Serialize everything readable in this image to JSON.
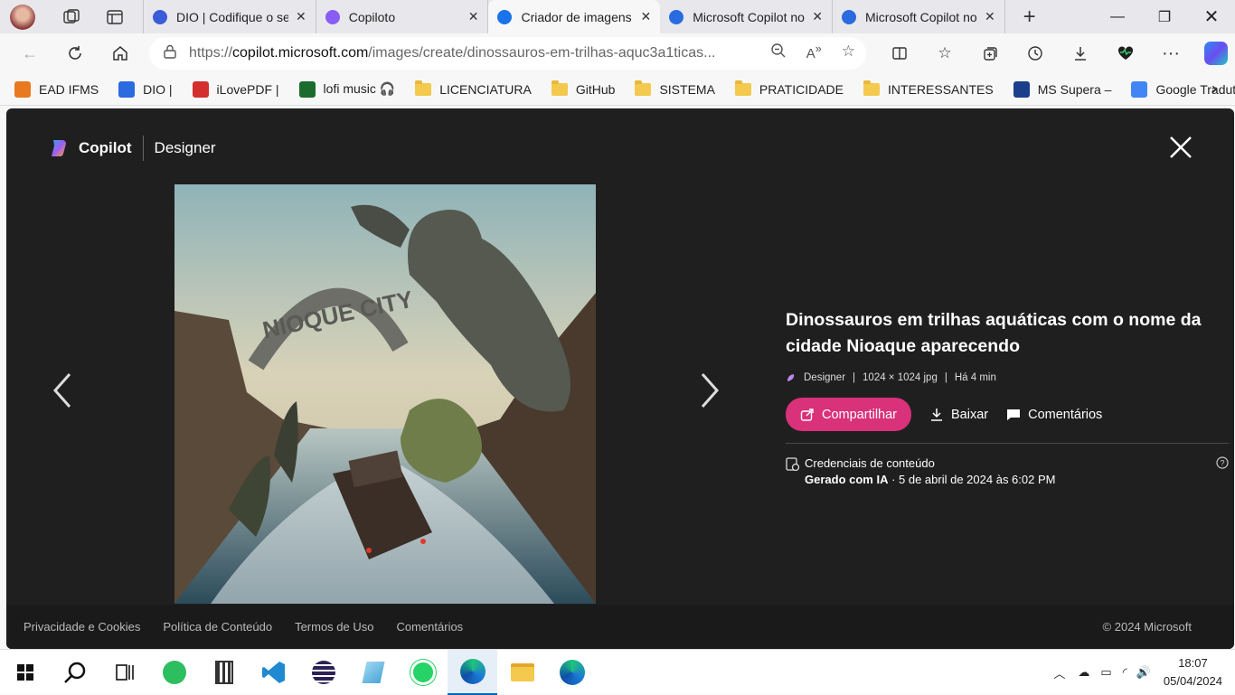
{
  "browser": {
    "tabs": [
      {
        "title": "DIO | Codifique o seu futuro",
        "color": "#3b5bd9"
      },
      {
        "title": "Copiloto",
        "color": "#8a5cf6"
      },
      {
        "title": "Criador de imagens",
        "color": "#1a73e8",
        "active": true
      },
      {
        "title": "Microsoft Copilot no Edge",
        "color": "#2a6be0"
      },
      {
        "title": "Microsoft Copilot no Edge",
        "color": "#2a6be0"
      }
    ],
    "url_prefix": "https://",
    "url_host": "copilot.microsoft.com",
    "url_path": "/images/create/dinossauros-em-trilhas-aquc3a1ticas...",
    "bookmarks": [
      {
        "label": "EAD IFMS",
        "type": "site"
      },
      {
        "label": "DIO |",
        "type": "site"
      },
      {
        "label": "iLovePDF |",
        "type": "site"
      },
      {
        "label": "lofi music 🎧",
        "type": "site"
      },
      {
        "label": "LICENCIATURA",
        "type": "folder"
      },
      {
        "label": "GitHub",
        "type": "folder"
      },
      {
        "label": "SISTEMA",
        "type": "folder"
      },
      {
        "label": "PRATICIDADE",
        "type": "folder"
      },
      {
        "label": "INTERESSANTES",
        "type": "folder"
      },
      {
        "label": "MS Supera –",
        "type": "site"
      },
      {
        "label": "Google Tradutor",
        "type": "site"
      }
    ]
  },
  "designer": {
    "brand": "Copilot",
    "product": "Designer",
    "image_sign_text": "NIOQUE CITY",
    "title": "Dinossauros em trilhas aquáticas com o nome da cidade Nioaque aparecendo",
    "meta": {
      "source": "Designer",
      "size": "1024 × 1024 jpg",
      "age": "Há 4 min"
    },
    "actions": {
      "share": "Compartilhar",
      "download": "Baixar",
      "comments": "Comentários"
    },
    "credentials": {
      "label": "Credenciais de conteúdo",
      "generated": "Gerado com IA",
      "date": " · 5 de abril de 2024 às 6:02 PM"
    },
    "footer": {
      "links": [
        "Privacidade e Cookies",
        "Política de Conteúdo",
        "Termos de Uso",
        "Comentários"
      ],
      "copyright": "© 2024 Microsoft"
    }
  },
  "taskbar": {
    "time": "18:07",
    "date": "05/04/2024"
  }
}
